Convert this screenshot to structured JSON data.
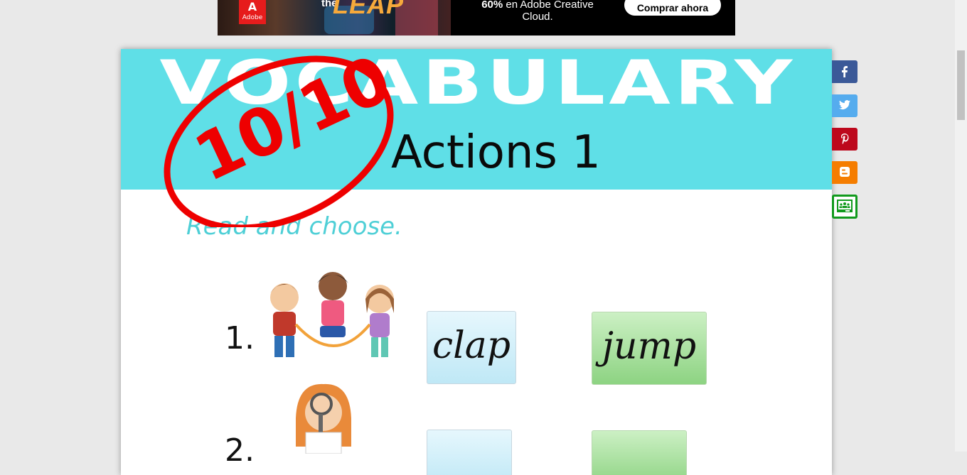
{
  "ad": {
    "brand": "Adobe",
    "the": "the",
    "leap": "LEAP",
    "offer_bold": "60%",
    "offer_rest": " en Adobe Creative Cloud.",
    "button": "Comprar ahora"
  },
  "worksheet": {
    "title": "VOCABULARY",
    "subtitle": "Actions 1",
    "score": "10/10",
    "instruction": "Read and choose.",
    "questions": [
      {
        "number": "1.",
        "choices": [
          "clap",
          "jump"
        ]
      },
      {
        "number": "2.",
        "choices": [
          "",
          ""
        ]
      }
    ]
  },
  "share": {
    "items": [
      {
        "name": "facebook",
        "color": "#3b5998",
        "glyph": "f"
      },
      {
        "name": "twitter",
        "color": "#55acee",
        "glyph": "t"
      },
      {
        "name": "pinterest",
        "color": "#bd081c",
        "glyph": "p"
      },
      {
        "name": "blogger",
        "color": "#f57d00",
        "glyph": "b"
      },
      {
        "name": "google-classroom",
        "color": "#0f9d58",
        "glyph": "c"
      }
    ]
  }
}
